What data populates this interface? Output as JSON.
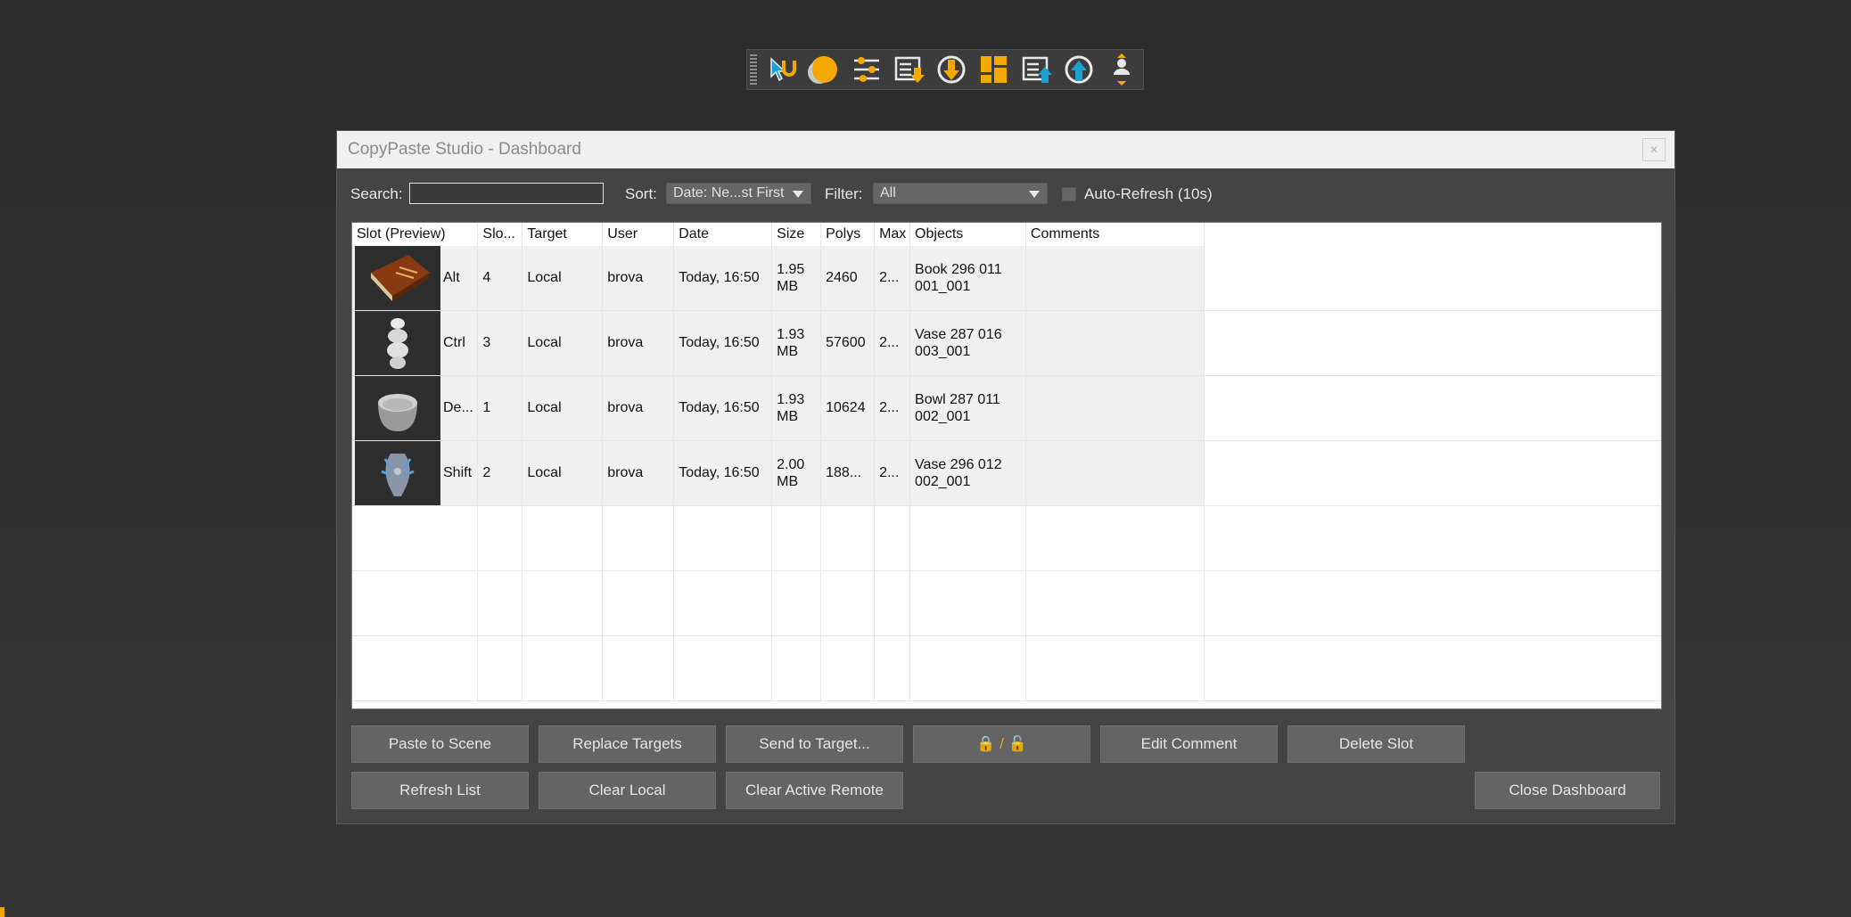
{
  "toolbar": {
    "icons": [
      "select-grab-icon",
      "material-sphere-icon",
      "settings-sliders-icon",
      "list-download-icon",
      "disk-download-icon",
      "layout-blocks-icon",
      "list-upload-icon",
      "disk-upload-icon",
      "user-transfer-icon"
    ]
  },
  "dialog": {
    "title": "CopyPaste Studio - Dashboard",
    "close_label": "×"
  },
  "controls": {
    "search_label": "Search:",
    "search_value": "",
    "sort_label": "Sort:",
    "sort_value": "Date: Ne...st First",
    "filter_label": "Filter:",
    "filter_value": "All",
    "auto_refresh_label": "Auto-Refresh (10s)",
    "auto_refresh_checked": false
  },
  "table": {
    "headers": [
      "Slot (Preview)",
      "Slo...",
      "Target",
      "User",
      "Date",
      "Size",
      "Polys",
      "Max",
      "Objects",
      "Comments"
    ],
    "rows": [
      {
        "slot": "Alt",
        "slot_no": "4",
        "target": "Local",
        "user": "brova",
        "date": "Today, 16:50",
        "size": "1.95 MB",
        "polys": "2460",
        "max": "2...",
        "objects": "Book 296 011 001_001",
        "comments": "",
        "thumb": "book"
      },
      {
        "slot": "Ctrl",
        "slot_no": "3",
        "target": "Local",
        "user": "brova",
        "date": "Today, 16:50",
        "size": "1.93 MB",
        "polys": "57600",
        "max": "2...",
        "objects": "Vase 287 016 003_001",
        "comments": "",
        "thumb": "vase-white"
      },
      {
        "slot": "De...",
        "slot_no": "1",
        "target": "Local",
        "user": "brova",
        "date": "Today, 16:50",
        "size": "1.93 MB",
        "polys": "10624",
        "max": "2...",
        "objects": "Bowl 287 011 002_001",
        "comments": "",
        "thumb": "bowl"
      },
      {
        "slot": "Shift",
        "slot_no": "2",
        "target": "Local",
        "user": "brova",
        "date": "Today, 16:50",
        "size": "2.00 MB",
        "polys": "188...",
        "max": "2...",
        "objects": "Vase 296 012 002_001",
        "comments": "",
        "thumb": "vase-blue"
      }
    ]
  },
  "buttons": {
    "paste_to_scene": "Paste to Scene",
    "replace_targets": "Replace Targets",
    "send_to_target": "Send to Target...",
    "lock_toggle": "🔒 / 🔓",
    "edit_comment": "Edit Comment",
    "delete_slot": "Delete Slot",
    "refresh_list": "Refresh List",
    "clear_local": "Clear Local",
    "clear_active_remote": "Clear Active Remote",
    "close_dashboard": "Close Dashboard"
  },
  "colors": {
    "accent": "#f5a800",
    "toolbar_blue": "#1ea0d0"
  }
}
